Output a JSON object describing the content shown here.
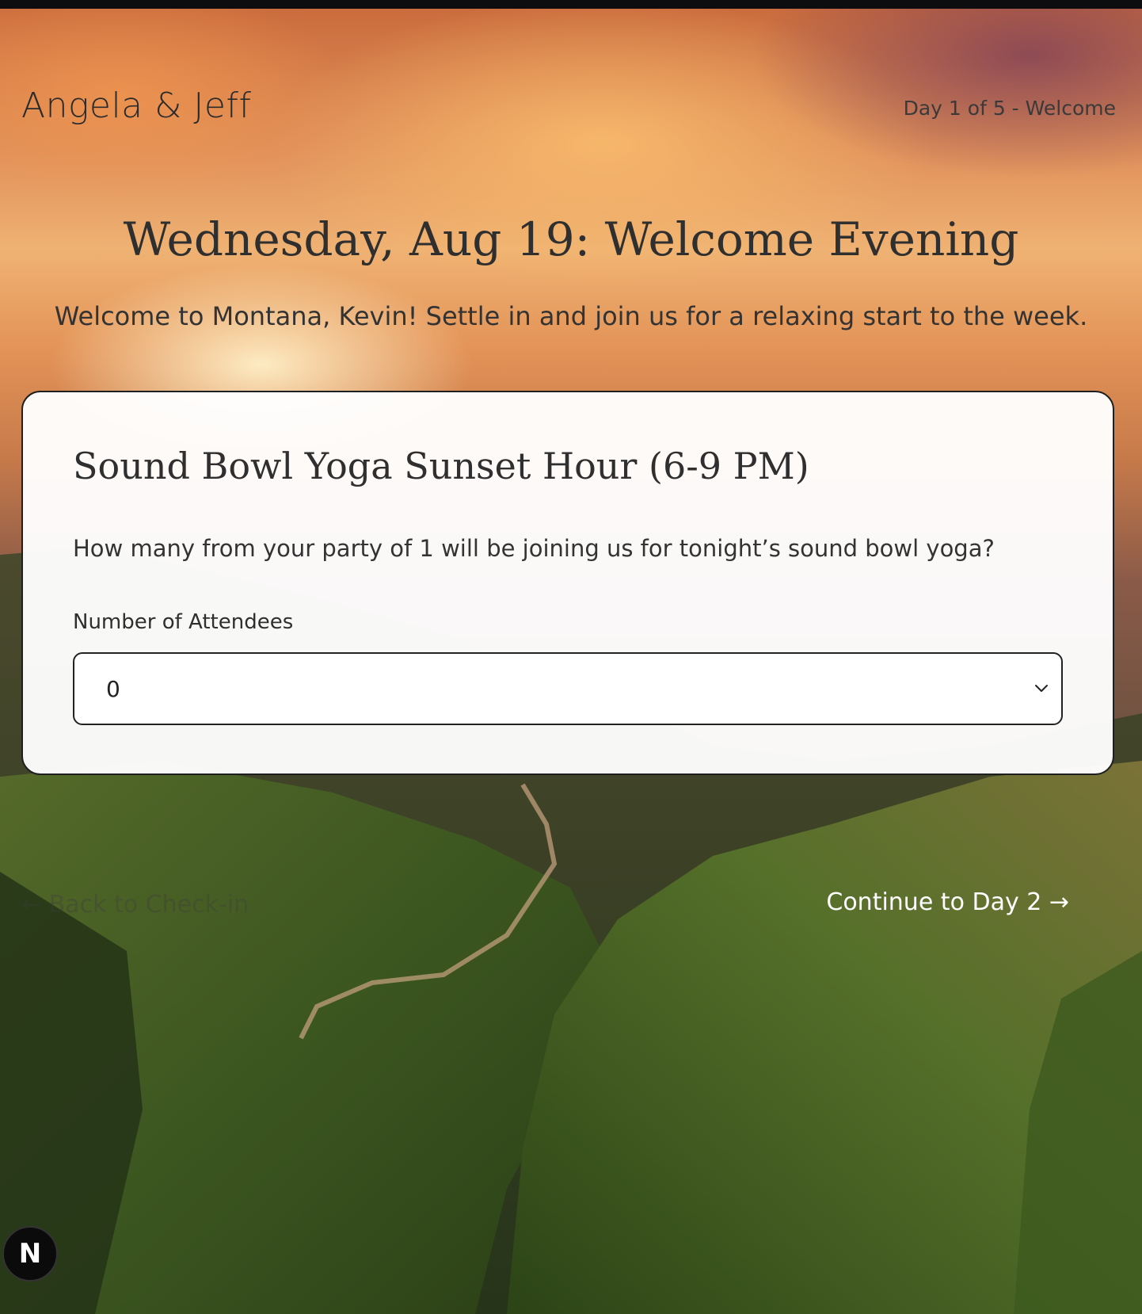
{
  "header": {
    "brand": "Angela & Jeff",
    "day_indicator": "Day 1 of 5 - Welcome"
  },
  "hero": {
    "title": "Wednesday, Aug 19: Welcome Evening",
    "subtitle": "Welcome to Montana, Kevin! Settle in and join us for a relaxing start to the week."
  },
  "event_card": {
    "title": "Sound Bowl Yoga Sunset Hour (6-9 PM)",
    "question": "How many from your party of 1 will be joining us for tonight’s sound bowl yoga?",
    "field_label": "Number of Attendees",
    "select_value": "0"
  },
  "navigation": {
    "back_label": "← Back to Check-in",
    "continue_label": "Continue to Day 2 →"
  },
  "dev_badge": {
    "letter": "N"
  },
  "colors": {
    "text_dark": "#2f2f2f",
    "card_bg": "#ffffff",
    "border": "#1f1f1f",
    "continue_text": "#ffffff"
  },
  "icons": {
    "select_chevron": "chevron-down-icon",
    "dev_badge": "next-logo-icon"
  }
}
